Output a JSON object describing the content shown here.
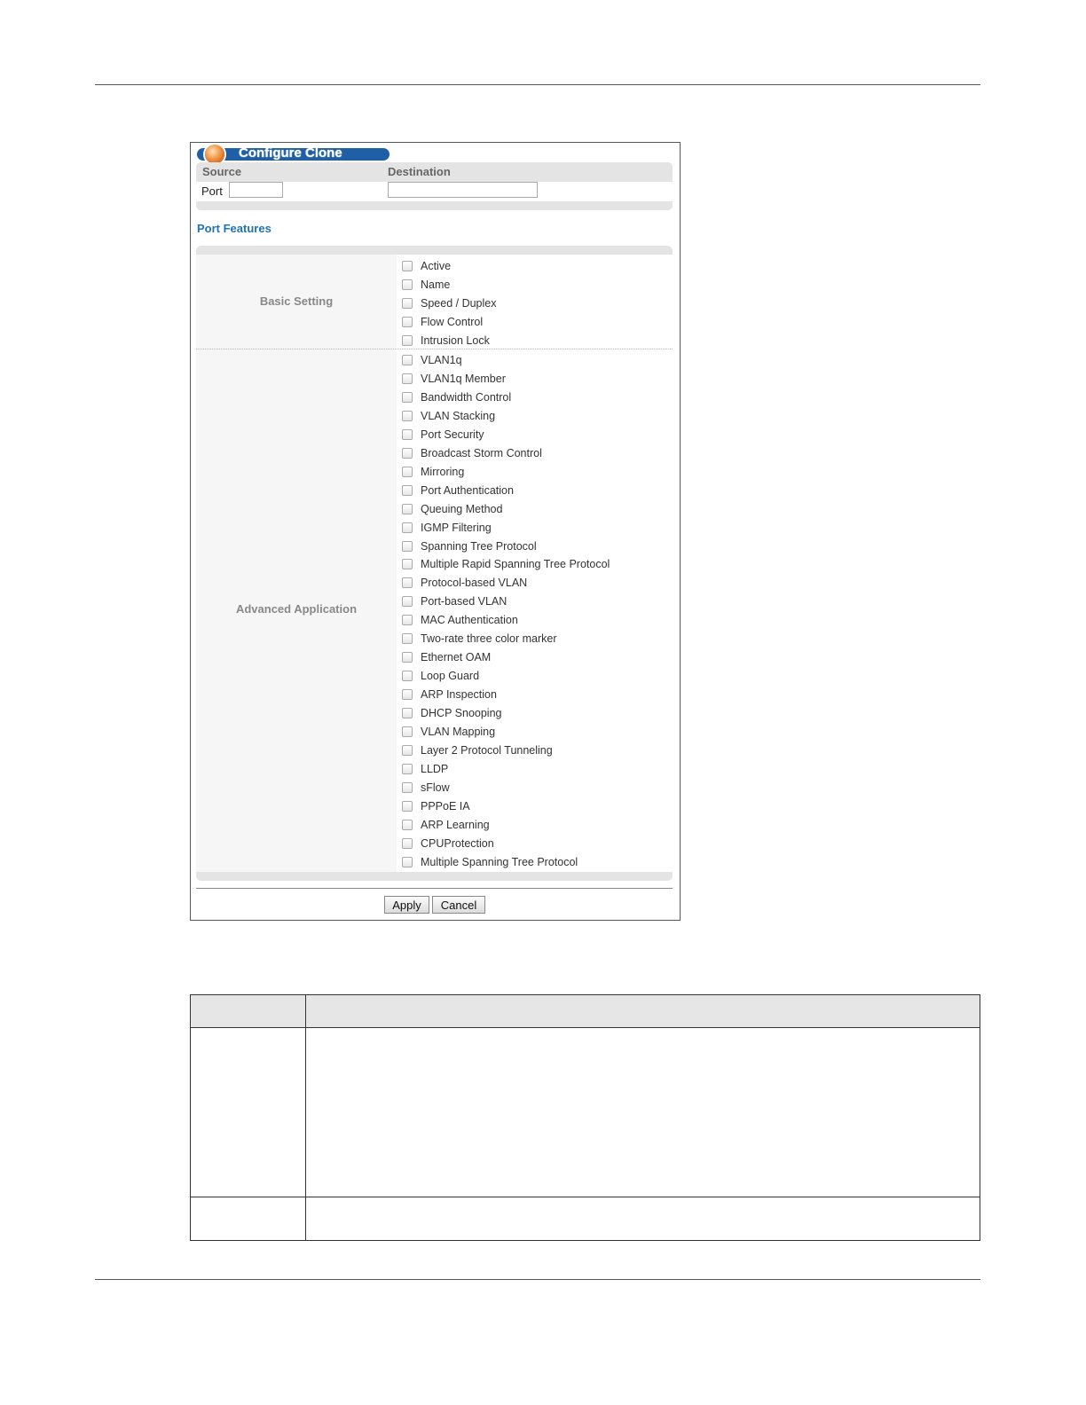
{
  "panel": {
    "title": "Configure Clone",
    "source_label": "Source",
    "destination_label": "Destination",
    "port_label": "Port",
    "source_port_value": "",
    "destination_port_value": "",
    "port_features_title": "Port Features",
    "basic_setting_label": "Basic Setting",
    "advanced_application_label": "Advanced Application",
    "basic_options": [
      {
        "label": "Active",
        "checked": false
      },
      {
        "label": "Name",
        "checked": false
      },
      {
        "label": "Speed / Duplex",
        "checked": false
      },
      {
        "label": "Flow Control",
        "checked": false
      },
      {
        "label": "Intrusion Lock",
        "checked": false
      }
    ],
    "advanced_options": [
      {
        "label": "VLAN1q",
        "checked": false
      },
      {
        "label": "VLAN1q Member",
        "checked": false
      },
      {
        "label": "Bandwidth Control",
        "checked": false
      },
      {
        "label": "VLAN Stacking",
        "checked": false
      },
      {
        "label": "Port Security",
        "checked": false
      },
      {
        "label": "Broadcast Storm Control",
        "checked": false
      },
      {
        "label": "Mirroring",
        "checked": false
      },
      {
        "label": "Port Authentication",
        "checked": false
      },
      {
        "label": "Queuing Method",
        "checked": false
      },
      {
        "label": "IGMP Filtering",
        "checked": false
      },
      {
        "label": "Spanning Tree Protocol",
        "checked": false
      },
      {
        "label": "Multiple Rapid Spanning Tree Protocol",
        "checked": false
      },
      {
        "label": "Protocol-based VLAN",
        "checked": false
      },
      {
        "label": "Port-based VLAN",
        "checked": false
      },
      {
        "label": "MAC Authentication",
        "checked": false
      },
      {
        "label": "Two-rate three color marker",
        "checked": false
      },
      {
        "label": "Ethernet OAM",
        "checked": false
      },
      {
        "label": "Loop Guard",
        "checked": false
      },
      {
        "label": "ARP Inspection",
        "checked": false
      },
      {
        "label": "DHCP Snooping",
        "checked": false
      },
      {
        "label": "VLAN Mapping",
        "checked": false
      },
      {
        "label": "Layer 2 Protocol Tunneling",
        "checked": false
      },
      {
        "label": "LLDP",
        "checked": false
      },
      {
        "label": "sFlow",
        "checked": false
      },
      {
        "label": "PPPoE IA",
        "checked": false
      },
      {
        "label": "ARP Learning",
        "checked": false
      },
      {
        "label": "CPUProtection",
        "checked": false
      },
      {
        "label": "Multiple Spanning Tree Protocol",
        "checked": false
      }
    ],
    "apply_label": "Apply",
    "cancel_label": "Cancel",
    "title_bar_color": "#1f5fa8",
    "features_title_color": "#1d74b6"
  }
}
